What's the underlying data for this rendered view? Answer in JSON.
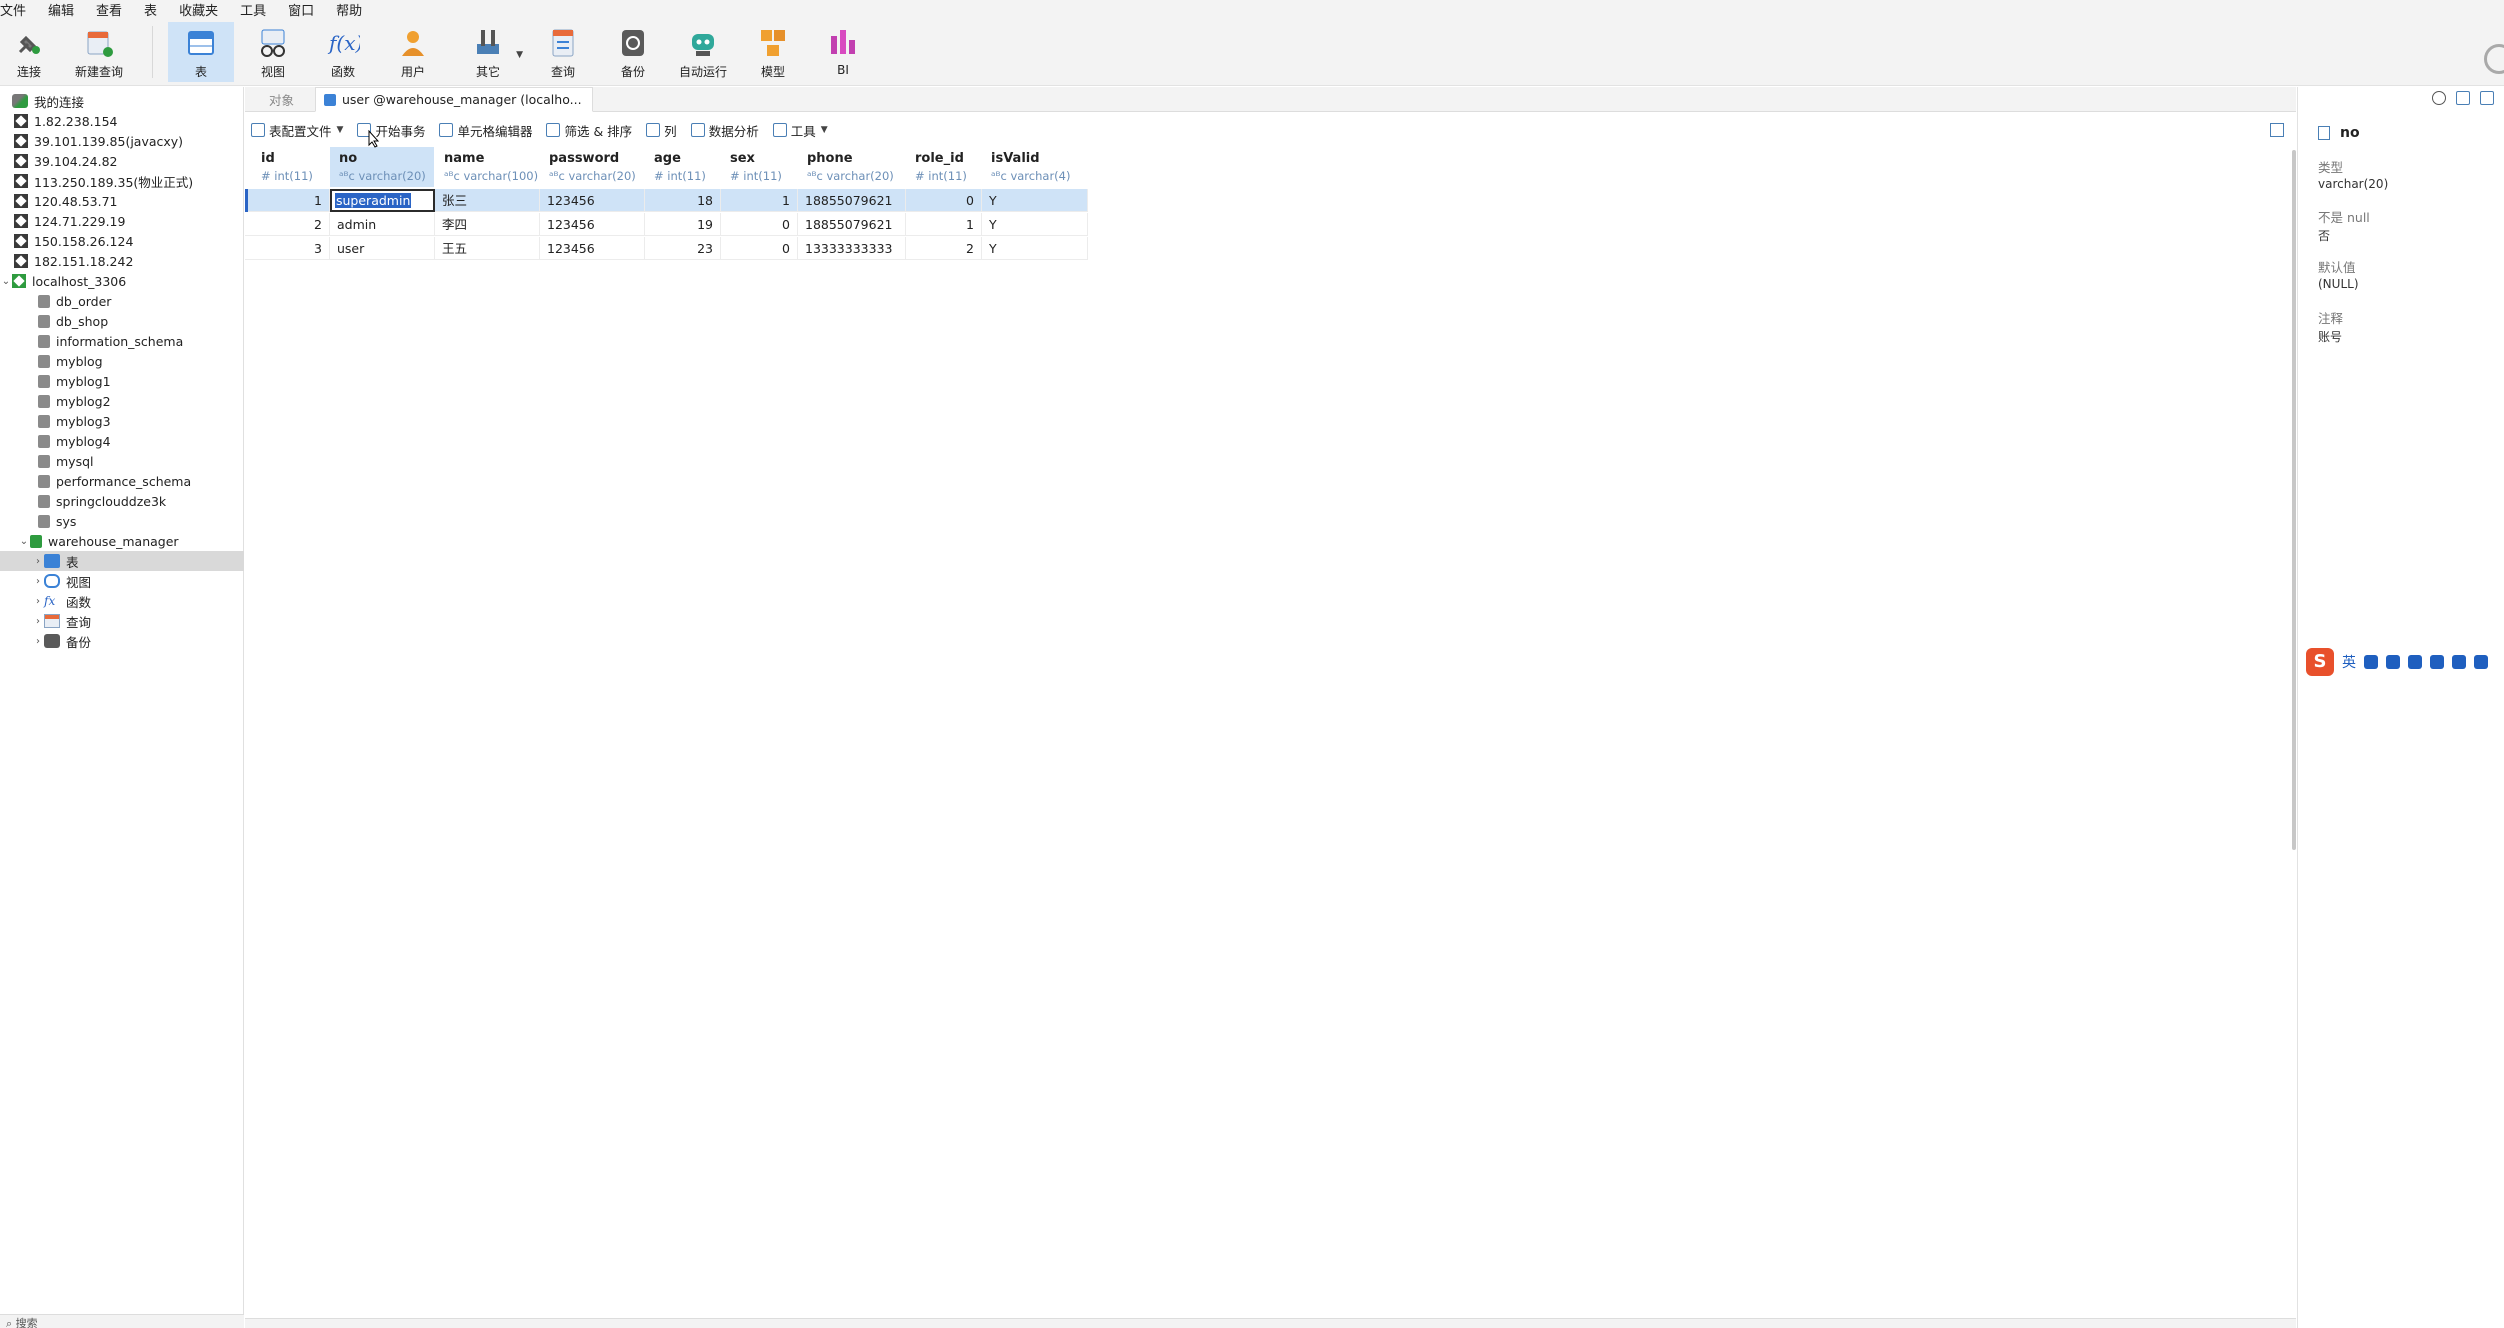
{
  "menu": [
    "文件",
    "编辑",
    "查看",
    "表",
    "收藏夹",
    "工具",
    "窗口",
    "帮助"
  ],
  "toolbar": {
    "items": [
      {
        "label": "连接",
        "icon": "connection-plug-icon"
      },
      {
        "label": "新建查询",
        "icon": "new-query-icon"
      },
      {
        "label": "表",
        "icon": "table-icon"
      },
      {
        "label": "视图",
        "icon": "view-glasses-icon"
      },
      {
        "label": "函数",
        "icon": "function-fx-icon"
      },
      {
        "label": "用户",
        "icon": "user-icon"
      },
      {
        "label": "其它",
        "icon": "tools-icon"
      },
      {
        "label": "查询",
        "icon": "query-icon"
      },
      {
        "label": "备份",
        "icon": "backup-icon"
      },
      {
        "label": "自动运行",
        "icon": "robot-icon"
      },
      {
        "label": "模型",
        "icon": "model-icon"
      },
      {
        "label": "BI",
        "icon": "bi-icon"
      }
    ]
  },
  "nav": {
    "root": "我的连接",
    "connections": [
      "1.82.238.154",
      "39.101.139.85(javacxy)",
      "39.104.24.82",
      "113.250.189.35(物业正式)",
      "120.48.53.71",
      "124.71.229.19",
      "150.158.26.124",
      "182.151.18.242"
    ],
    "localhost": "localhost_3306",
    "databases": [
      "db_order",
      "db_shop",
      "information_schema",
      "myblog",
      "myblog1",
      "myblog2",
      "myblog3",
      "myblog4",
      "mysql",
      "performance_schema",
      "springclouddze3k",
      "sys"
    ],
    "active_db": "warehouse_manager",
    "db_children": [
      "表",
      "视图",
      "函数",
      "查询",
      "备份"
    ],
    "search_label": "搜索"
  },
  "tabs": {
    "objects": "对象",
    "active": "user @warehouse_manager (localho..."
  },
  "subtoolbar": {
    "table_profile": "表配置文件",
    "begin_tx": "开始事务",
    "cell_editor": "单元格编辑器",
    "filter_sort": "筛选 & 排序",
    "columns": "列",
    "data_analysis": "数据分析",
    "tools": "工具"
  },
  "grid": {
    "columns": [
      {
        "name": "id",
        "type": "# int(11)"
      },
      {
        "name": "no",
        "type": "ᵃᴮc varchar(20)"
      },
      {
        "name": "name",
        "type": "ᵃᴮc varchar(100)"
      },
      {
        "name": "password",
        "type": "ᵃᴮc varchar(20)"
      },
      {
        "name": "age",
        "type": "# int(11)"
      },
      {
        "name": "sex",
        "type": "# int(11)"
      },
      {
        "name": "phone",
        "type": "ᵃᴮc varchar(20)"
      },
      {
        "name": "role_id",
        "type": "# int(11)"
      },
      {
        "name": "isValid",
        "type": "ᵃᴮc varchar(4)"
      }
    ],
    "rows": [
      [
        "1",
        "superadmin",
        "张三",
        "123456",
        "18",
        "1",
        "18855079621",
        "0",
        "Y"
      ],
      [
        "2",
        "admin",
        "李四",
        "123456",
        "19",
        "0",
        "18855079621",
        "1",
        "Y"
      ],
      [
        "3",
        "user",
        "王五",
        "123456",
        "23",
        "0",
        "13333333333",
        "2",
        "Y"
      ]
    ]
  },
  "details": {
    "field": "no",
    "type_label": "类型",
    "type_value": "varchar(20)",
    "notnull_label": "不是 null",
    "notnull_value": "否",
    "default_label": "默认值",
    "default_value": "(NULL)",
    "comment_label": "注释",
    "comment_value": "账号"
  },
  "ime": {
    "logo": "S",
    "lang": "英"
  },
  "colors": {
    "accent": "#2a64c5",
    "selection": "#cfe3f7",
    "type_text": "#6c8fb7"
  }
}
